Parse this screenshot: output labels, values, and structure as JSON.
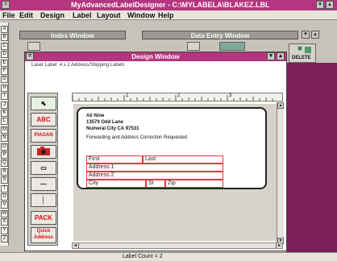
{
  "app": {
    "title": "MyAdvancedLabelDesigner - C:\\MYLABELA\\BLAKEZ.LBL"
  },
  "menu": [
    {
      "label": "File",
      "u": "F"
    },
    {
      "label": "Edit",
      "u": "E"
    },
    {
      "label": "Design",
      "u": "D"
    },
    {
      "label": "Label",
      "u": "L"
    },
    {
      "label": "Layout",
      "u": "o"
    },
    {
      "label": "Window",
      "u": "W"
    },
    {
      "label": "Help",
      "u": "H"
    }
  ],
  "index_window": {
    "title": "Index Window"
  },
  "data_entry_window": {
    "title": "Data Entry Window"
  },
  "toolbar": {
    "delete_label": "DELETE"
  },
  "left_ruler_letters": [
    "A",
    "B",
    "C",
    "D",
    "E",
    "F",
    "G",
    "H",
    "I",
    "J",
    "K",
    "L",
    "M",
    "N",
    "O",
    "P",
    "Q",
    "R",
    "S",
    "T",
    "U",
    "V",
    "W",
    "X",
    "Y",
    "Z"
  ],
  "design_window": {
    "title": "Design Window",
    "label_format": "Laser Label: 4 x 2  Address/Shipping Labels"
  },
  "ruler": {
    "ticks": [
      "1",
      "2",
      "3"
    ]
  },
  "tools": {
    "abc": "ABC",
    "pagan": "PIAGAN",
    "pack": "PACK",
    "quick_address": "Quick Address"
  },
  "label": {
    "return_address": [
      "Ali Nine",
      "13579 Odd Lane",
      "Numeral City CA 97531"
    ],
    "endorsement": "Forwarding and Address Correction Requested",
    "fields": {
      "first": "First",
      "last": "Last",
      "address1": "Address 1",
      "address2": "Address 2",
      "city": "City",
      "st": "St",
      "zip": "Zip"
    }
  },
  "status": {
    "label_count": "Label Count = 2"
  },
  "colors": {
    "titlebar": "#b5367e",
    "field_border": "#e23a3a",
    "mdi_background": "#7a1f59"
  }
}
